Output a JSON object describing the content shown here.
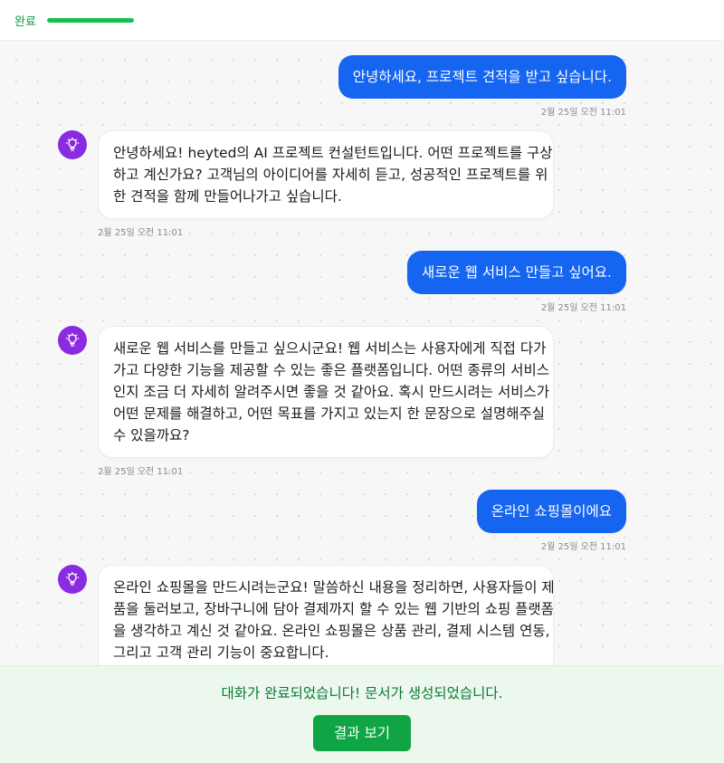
{
  "header": {
    "status_label": "완료",
    "progress": 1.0,
    "accent": "#14c152"
  },
  "messages": [
    {
      "role": "user",
      "text": "안녕하세요, 프로젝트 견적을 받고 싶습니다.",
      "timestamp": "2월 25일 오전 11:01"
    },
    {
      "role": "assistant",
      "lines": [
        "안녕하세요! heyted의 AI 프로젝트 컨설턴트입니다. 어떤 프로젝트를 구상",
        "하고 계신가요? 고객님의 아이디어를 자세히 듣고, 성공적인 프로젝트를 위",
        "한 견적을 함께 만들어나가고 싶습니다."
      ],
      "timestamp": "2월 25일 오전 11:01",
      "icon": "lightbulb-icon"
    },
    {
      "role": "user",
      "text": "새로운 웹 서비스 만들고 싶어요.",
      "timestamp": "2월 25일 오전 11:01"
    },
    {
      "role": "assistant",
      "lines": [
        "새로운 웹 서비스를 만들고 싶으시군요! 웹 서비스는 사용자에게 직접 다가",
        "가고 다양한 기능을 제공할 수 있는 좋은 플랫폼입니다. 어떤 종류의 서비스",
        "인지 조금 더 자세히 알려주시면 좋을 것 같아요. 혹시 만드시려는 서비스가",
        "어떤 문제를 해결하고, 어떤 목표를 가지고 있는지 한 문장으로 설명해주실",
        "수 있을까요?"
      ],
      "timestamp": "2월 25일 오전 11:01",
      "icon": "lightbulb-icon"
    },
    {
      "role": "user",
      "text": "온라인 쇼핑몰이에요",
      "timestamp": "2월 25일 오전 11:01"
    },
    {
      "role": "assistant",
      "lines": [
        "온라인 쇼핑몰을 만드시려는군요! 말씀하신 내용을 정리하면, 사용자들이 제",
        "품을 둘러보고, 장바구니에 담아 결제까지 할 수 있는 웹 기반의 쇼핑 플랫폼",
        "을 생각하고 계신 것 같아요. 온라인 쇼핑몰은 상품 관리, 결제 시스템 연동,",
        "그리고 고객 관리 기능이 중요합니다."
      ],
      "timestamp": "",
      "icon": "lightbulb-icon"
    }
  ],
  "footer": {
    "done_text": "대화가 완료되었습니다! 문서가 생성되었습니다.",
    "result_button_label": "결과 보기"
  }
}
